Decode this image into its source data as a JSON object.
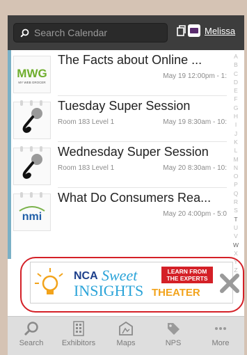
{
  "header": {
    "search_placeholder": "Search Calendar",
    "user_name": "Melissa"
  },
  "sessions": [
    {
      "title": "The Facts about Online ...",
      "location": "",
      "time": "May 19 12:00pm - 1:",
      "logo": "MWG"
    },
    {
      "title": "Tuesday Super Session",
      "location": "Room 183 Level 1",
      "time": "May 19 8:30am - 10:",
      "logo": "microphone-icon"
    },
    {
      "title": "Wednesday Super Session",
      "location": "Room 183 Level 1",
      "time": "May 20 8:30am - 10:",
      "logo": "microphone-icon"
    },
    {
      "title": "What Do Consumers Rea...",
      "location": "",
      "time": "May 20 4:00pm - 5:0",
      "logo": "nmi"
    }
  ],
  "logos": {
    "mwg_text": "MWG",
    "mwg_sub": "MY WEB GROCER",
    "nmi_text": "nmi"
  },
  "alphabet": [
    "A",
    "B",
    "C",
    "D",
    "E",
    "F",
    "G",
    "H",
    "I",
    "J",
    "K",
    "L",
    "M",
    "N",
    "O",
    "P",
    "Q",
    "R",
    "S",
    "T",
    "U",
    "V",
    "W",
    "X",
    "Y",
    "Z"
  ],
  "ad": {
    "nca": "NCA",
    "sweet": "Sweet",
    "insights": "INSIGHTS",
    "theater": "THEATER",
    "learn_line1": "LEARN FROM",
    "learn_line2": "THE EXPERTS"
  },
  "tabs": [
    {
      "label": "Search",
      "icon": "search-icon"
    },
    {
      "label": "Exhibitors",
      "icon": "exhibitors-icon"
    },
    {
      "label": "Maps",
      "icon": "maps-icon"
    },
    {
      "label": "NPS",
      "icon": "tag-icon"
    },
    {
      "label": "More",
      "icon": "more-icon"
    }
  ],
  "colors": {
    "header_bg": "#3d3d3d",
    "accent_bar": "#7ab0c6",
    "ad_ring": "#d42027",
    "tabbar_bg": "#dedede"
  }
}
